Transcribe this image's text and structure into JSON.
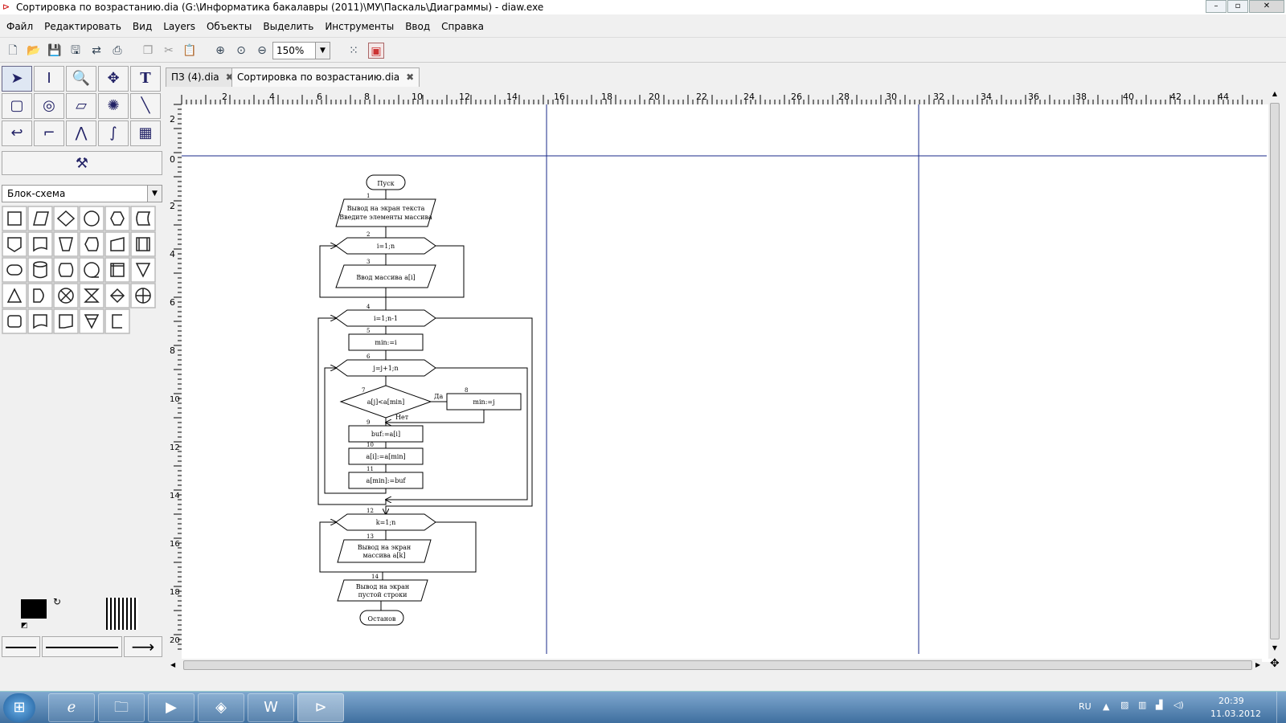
{
  "window": {
    "title": "Сортировка по возрастанию.dia (G:\\Информатика бакалавры (2011)\\МУ\\Паскаль\\Диаграммы) - diaw.exe"
  },
  "menu": [
    "Файл",
    "Редактировать",
    "Вид",
    "Layers",
    "Объекты",
    "Выделить",
    "Инструменты",
    "Ввод",
    "Справка"
  ],
  "toolbar": {
    "zoom": "150%"
  },
  "toolbox": {
    "sheet": "Блок-схема"
  },
  "tabs": [
    {
      "label": "ПЗ (4).dia"
    },
    {
      "label": "Сортировка по возрастанию.dia"
    }
  ],
  "ruler": {
    "h": [
      "2",
      "4",
      "6",
      "8",
      "10",
      "12",
      "14",
      "16",
      "18",
      "20",
      "22",
      "24",
      "26",
      "28",
      "30",
      "32",
      "34",
      "36",
      "38",
      "40",
      "42",
      "44"
    ],
    "v": [
      "2",
      "0",
      "2",
      "4",
      "6",
      "8",
      "10",
      "12",
      "14",
      "16",
      "18",
      "20"
    ]
  },
  "flow": {
    "start": "Пуск",
    "b1": {
      "n": "1",
      "l1": "Вывод на экран текста",
      "l2": "Введите элементы массива"
    },
    "b2": {
      "n": "2",
      "t": "i=1;n"
    },
    "b3": {
      "n": "3",
      "t": "Ввод массива a[i]"
    },
    "b4": {
      "n": "4",
      "t": "i=1;n-1"
    },
    "b5": {
      "n": "5",
      "t": "min:=i"
    },
    "b6": {
      "n": "6",
      "t": "j=j+1;n"
    },
    "b7": {
      "n": "7",
      "t": "a[j]<a[min]",
      "yes": "Да",
      "no": "Нет"
    },
    "b8": {
      "n": "8",
      "t": "min:=j"
    },
    "b9": {
      "n": "9",
      "t": "buf:=a[i]"
    },
    "b10": {
      "n": "10",
      "t": "a[i]:=a[min]"
    },
    "b11": {
      "n": "11",
      "t": "a[min]:=buf"
    },
    "b12": {
      "n": "12",
      "t": "k=1;n"
    },
    "b13": {
      "n": "13",
      "l1": "Вывод на экран",
      "l2": "массива a[k]"
    },
    "b14": {
      "n": "14",
      "l1": "Вывод на экран",
      "l2": "пустой строки"
    },
    "stop": "Останов"
  },
  "tray": {
    "lang": "RU",
    "time": "20:39",
    "date": "11.03.2012"
  }
}
